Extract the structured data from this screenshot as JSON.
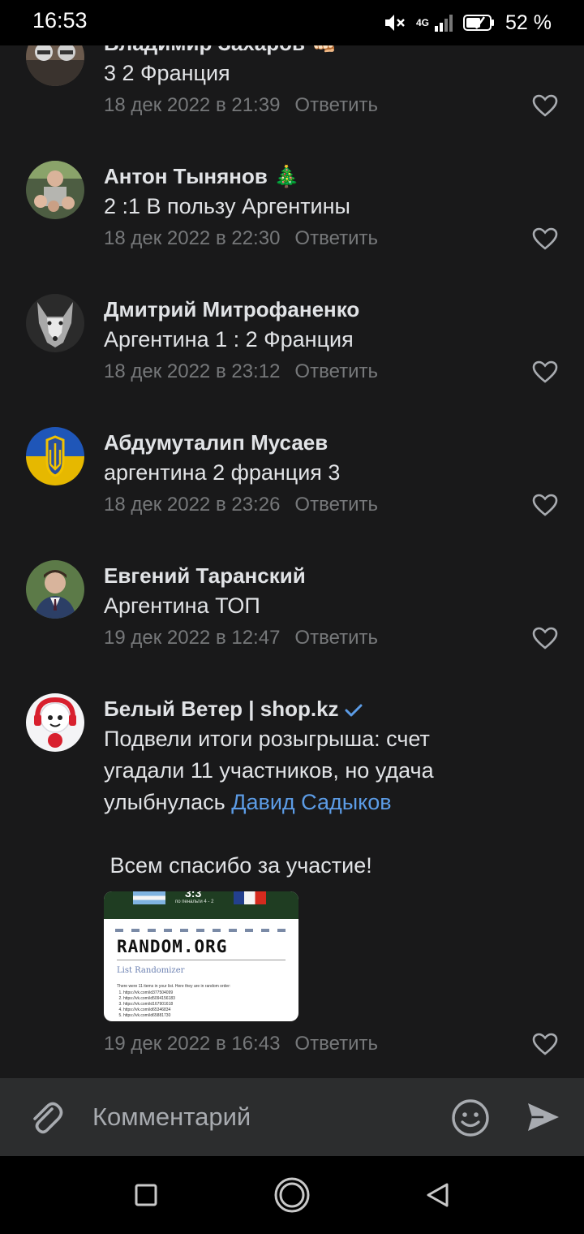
{
  "status_bar": {
    "time": "16:53",
    "network": "4G",
    "battery": "52 %"
  },
  "comments": [
    {
      "author": "Владимир Захаров 👊🏻",
      "text": "3 2 Франция",
      "date": "18 дек 2022 в 21:39",
      "reply": "Ответить"
    },
    {
      "author": "Антон Тынянов 🎄",
      "text": "2 :1 В пользу Аргентины",
      "date": "18 дек 2022 в 22:30",
      "reply": "Ответить"
    },
    {
      "author": "Дмитрий Митрофаненко",
      "text": "Аргентина 1 : 2 Франция",
      "date": "18 дек 2022 в 23:12",
      "reply": "Ответить"
    },
    {
      "author": "Абдумуталип Мусаев",
      "text": "аргентина 2 франция 3",
      "date": "18 дек 2022 в 23:26",
      "reply": "Ответить"
    },
    {
      "author": "Евгений Таранский",
      "text": "Аргентина ТОП",
      "date": "19 дек 2022 в 12:47",
      "reply": "Ответить"
    },
    {
      "author": "Белый Ветер | shop.kz",
      "text_line1": "Подвели итоги розыгрыша: счет",
      "text_line2": "угадали 11 участников, но удача",
      "text_line3_prefix": "улыбнулась ",
      "mention": "Давид Садыков",
      "text_line4": " Всем спасибо за участие!",
      "date": "19 дек 2022 в 16:43",
      "reply": "Ответить",
      "attachment": {
        "score": "3:3",
        "penalty": "по пенальти 4 - 2",
        "logo": "RANDOM.ORG",
        "heading": "List Randomizer",
        "intro": "There were 11 items in your list. Here they are in random order:",
        "items": [
          "https://vk.com/id377504099",
          "https://vk.com/id5094156183",
          "https://vk.com/id167901618",
          "https://vk.com/id65346834",
          "https://vk.com/id65881730"
        ]
      }
    }
  ],
  "composer": {
    "placeholder": "Комментарий"
  },
  "colors": {
    "background": "#19191a",
    "accent": "#5c9ce6",
    "secondary_text": "#76787a"
  }
}
